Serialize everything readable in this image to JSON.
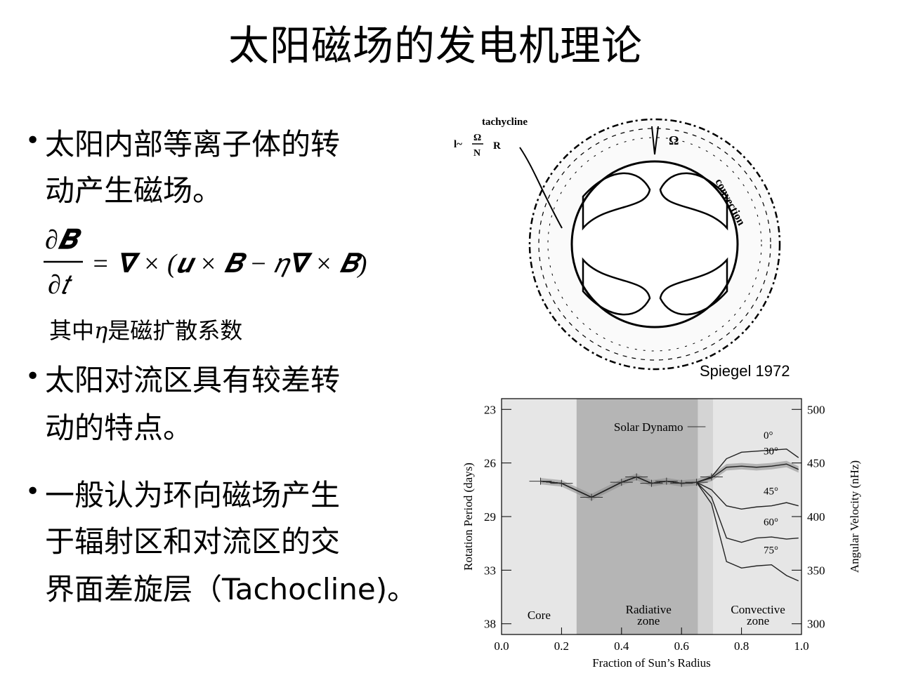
{
  "title": "太阳磁场的发电机理论",
  "bullets": [
    {
      "lines": [
        "太阳内部等离子体的转",
        "动产生磁场。"
      ]
    },
    {
      "lines": [
        "太阳对流区具有较差转",
        "动的特点。"
      ]
    },
    {
      "lines": [
        "一般认为环向磁场产生",
        "于辐射区和对流区的交",
        "界面差旋层（Tachocline)。"
      ]
    }
  ],
  "equation": {
    "numerator": "∂𝑩",
    "denominator": "∂𝑡",
    "rhs": "= 𝛁 × (𝒖 × 𝑩 − 𝜂𝛁 × 𝑩)"
  },
  "eta_note": {
    "pre": "其中",
    "symbol": "η",
    "post": "是磁扩散系数"
  },
  "diagram": {
    "label_tachycline": "tachycline",
    "label_l_formula": "l~",
    "label_omega": "Ω",
    "label_n": "N",
    "label_r": "R",
    "label_omega_top": "Ω",
    "label_convection": "convection",
    "caption": "Spiegel 1972"
  },
  "chart_data": {
    "type": "line",
    "xlabel": "Fraction of Sun’s Radius",
    "ylabel_left": "Rotation Period (days)",
    "ylabel_right": "Angular Velocity (nHz)",
    "x_ticks": [
      "0.0",
      "0.2",
      "0.4",
      "0.6",
      "0.8",
      "1.0"
    ],
    "y_left_ticks": [
      "23",
      "26",
      "29",
      "33",
      "38"
    ],
    "y_right_ticks": [
      "500",
      "450",
      "400",
      "350",
      "300"
    ],
    "xlim": [
      0,
      1
    ],
    "ylim_right": [
      290,
      510
    ],
    "regions": [
      {
        "label": "Core",
        "from": 0.0,
        "to": 0.25,
        "shade": "#e6e6e6"
      },
      {
        "label": "Radiative zone",
        "from": 0.25,
        "to": 0.655,
        "shade": "#b5b5b5"
      },
      {
        "label": "",
        "from": 0.655,
        "to": 0.705,
        "shade": "#d4d4d4"
      },
      {
        "label": "Convective zone",
        "from": 0.705,
        "to": 1.0,
        "shade": "#e6e6e6"
      }
    ],
    "annotation": "Solar Dynamo",
    "region_labels": {
      "core": "Core",
      "radiative_1": "Radiative",
      "radiative_2": "zone",
      "convective_1": "Convective",
      "convective_2": "zone"
    },
    "series": [
      {
        "name": "0°",
        "x": [
          0.13,
          0.2,
          0.3,
          0.4,
          0.45,
          0.5,
          0.55,
          0.6,
          0.65,
          0.7,
          0.75,
          0.8,
          0.85,
          0.9,
          0.95,
          0.99
        ],
        "y": [
          433,
          431,
          418,
          432,
          437,
          431,
          433,
          431,
          432,
          437,
          454,
          460,
          461,
          462,
          463,
          455
        ]
      },
      {
        "name": "30°",
        "x": [
          0.13,
          0.2,
          0.3,
          0.4,
          0.45,
          0.5,
          0.55,
          0.6,
          0.65,
          0.7,
          0.75,
          0.8,
          0.85,
          0.9,
          0.95,
          0.99
        ],
        "y": [
          433,
          431,
          418,
          432,
          437,
          431,
          433,
          431,
          432,
          436,
          446,
          447,
          446,
          447,
          449,
          444
        ]
      },
      {
        "name": "45°",
        "x": [
          0.13,
          0.2,
          0.3,
          0.4,
          0.45,
          0.5,
          0.55,
          0.6,
          0.65,
          0.7,
          0.75,
          0.8,
          0.85,
          0.9,
          0.95,
          0.99
        ],
        "y": [
          433,
          431,
          418,
          432,
          437,
          431,
          433,
          431,
          432,
          425,
          410,
          407,
          409,
          410,
          413,
          410
        ]
      },
      {
        "name": "60°",
        "x": [
          0.13,
          0.2,
          0.3,
          0.4,
          0.45,
          0.5,
          0.55,
          0.6,
          0.65,
          0.7,
          0.75,
          0.8,
          0.85,
          0.9,
          0.95,
          0.99
        ],
        "y": [
          433,
          431,
          418,
          432,
          437,
          431,
          433,
          431,
          432,
          418,
          380,
          376,
          380,
          381,
          379,
          380
        ]
      },
      {
        "name": "75°",
        "x": [
          0.13,
          0.2,
          0.3,
          0.4,
          0.45,
          0.5,
          0.55,
          0.6,
          0.65,
          0.7,
          0.75,
          0.8,
          0.85,
          0.9,
          0.95,
          0.99
        ],
        "y": [
          433,
          431,
          418,
          432,
          437,
          431,
          433,
          431,
          432,
          412,
          358,
          352,
          354,
          355,
          345,
          340
        ]
      }
    ]
  }
}
